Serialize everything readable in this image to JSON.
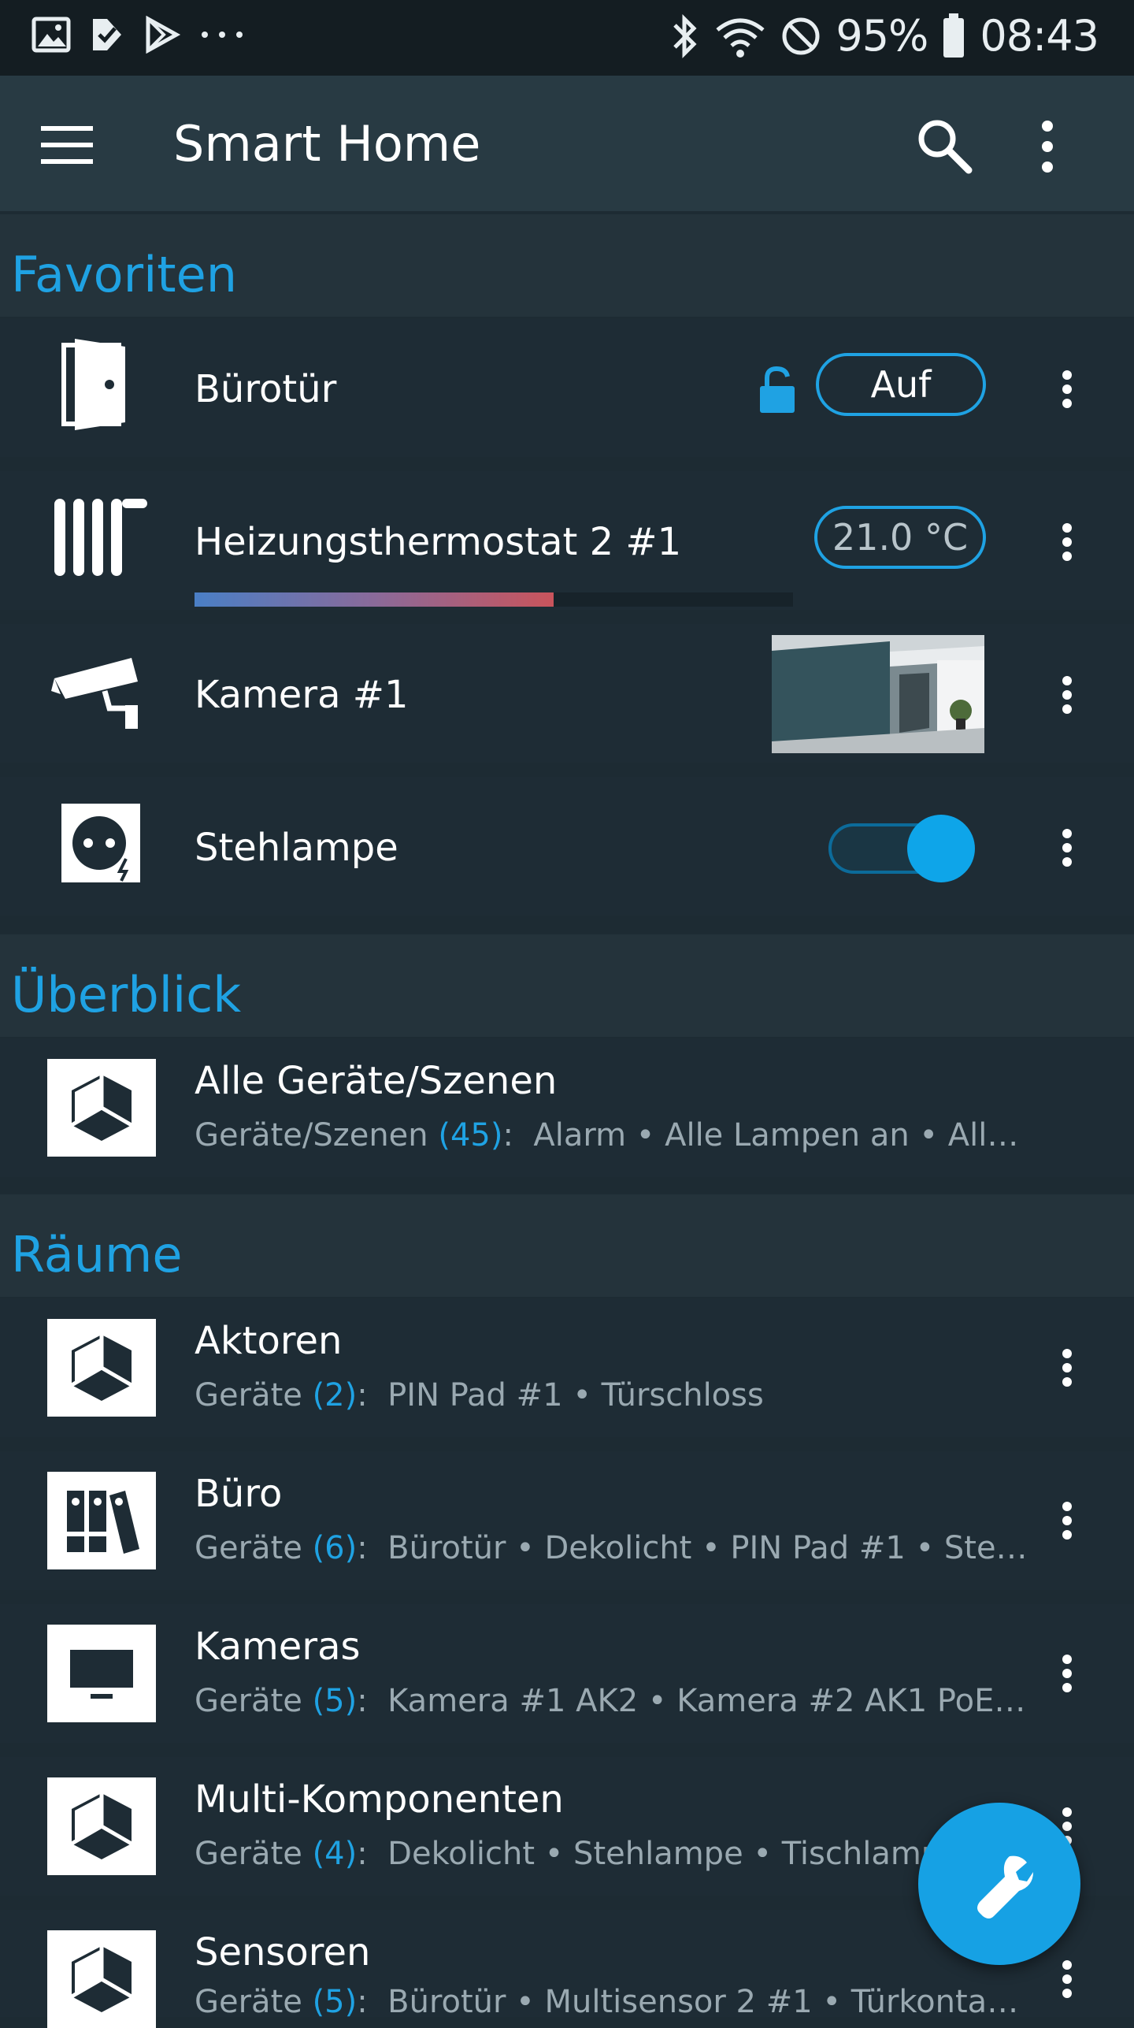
{
  "status_bar": {
    "battery": "95%",
    "time": "08:43"
  },
  "app_bar": {
    "title": "Smart Home"
  },
  "sections": {
    "favorites": "Favoriten",
    "overview": "Überblick",
    "rooms": "Räume"
  },
  "favorites": [
    {
      "title": "Bürotür",
      "action_label": "Auf"
    },
    {
      "title": "Heizungsthermostat 2 #1",
      "temperature": "21.0 °C",
      "level": 0.6
    },
    {
      "title": "Kamera #1"
    },
    {
      "title": "Stehlampe",
      "toggle_on": true
    }
  ],
  "overview": {
    "title": "Alle Geräte/Szenen",
    "sub_label": "Geräte/Szenen",
    "sub_count": "(45)",
    "sub_items": "Alarm • Alle Lampen an • All…"
  },
  "rooms": [
    {
      "title": "Aktoren",
      "sub_label": "Geräte",
      "sub_count": "(2)",
      "sub_items": "PIN Pad #1 • Türschloss"
    },
    {
      "title": "Büro",
      "sub_label": "Geräte",
      "sub_count": "(6)",
      "sub_items": "Bürotür • Dekolicht • PIN Pad #1 • Ste…"
    },
    {
      "title": "Kameras",
      "sub_label": "Geräte",
      "sub_count": "(5)",
      "sub_items": "Kamera #1 AK2 • Kamera #2 AK1 PoE…"
    },
    {
      "title": "Multi-Komponenten",
      "sub_label": "Geräte",
      "sub_count": "(4)",
      "sub_items": "Dekolicht • Stehlampe • Tischlampe"
    },
    {
      "title": "Sensoren",
      "sub_label": "Geräte",
      "sub_count": "(5)",
      "sub_items": "Bürotür • Multisensor 2 #1 • Türkonta…"
    }
  ],
  "colors": {
    "accent": "#1fa2e3",
    "background": "#1d2b33",
    "app_bar": "#283a43"
  }
}
